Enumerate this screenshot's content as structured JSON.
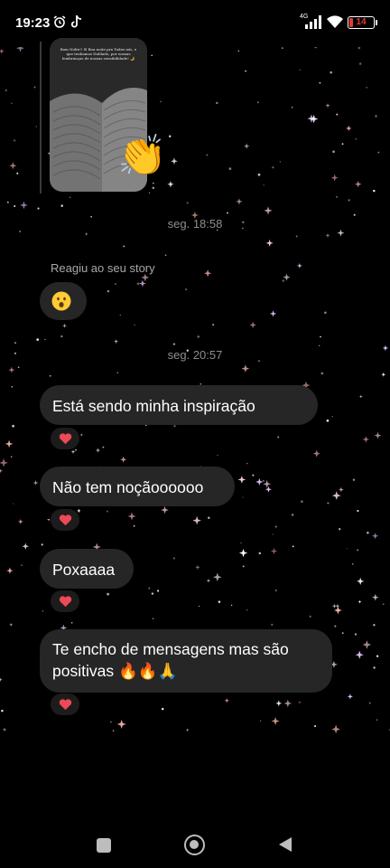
{
  "status_bar": {
    "time": "19:23",
    "network": "4G",
    "battery_level": "14",
    "icons": [
      "alarm-clock-icon",
      "tiktok-icon",
      "signal-icon",
      "wifi-icon",
      "battery-icon"
    ]
  },
  "story": {
    "caption": "Bom Nolte!! ☺ Boa noite pra Todos nós, e que tenhamos Dulilado, por nossas lembranças de nossas sensibilidade! 🌙",
    "reaction_emoji": "👏"
  },
  "messages": {
    "timestamp_1": "seg. 18:58",
    "story_reaction_label": "Reagiu ao seu story",
    "story_reaction_emoji": "surprised-face-icon",
    "timestamp_2": "seg. 20:57",
    "items": [
      {
        "text": "Está sendo minha inspiração",
        "reaction": "heart-icon"
      },
      {
        "text": "Não tem noçãoooooo",
        "reaction": "heart-icon"
      },
      {
        "text": "Poxaaaa",
        "reaction": "heart-icon"
      },
      {
        "text": "Te encho de mensagens mas são positivas 🔥🔥🙏",
        "reaction": "heart-icon"
      }
    ]
  },
  "colors": {
    "background": "#000000",
    "bubble": "#262626",
    "timestamp": "#8e8e8e",
    "heart": "#ed4956",
    "battery_low": "#e53935"
  },
  "nav_bar": {
    "icons": [
      "recent-apps-icon",
      "home-icon",
      "back-icon"
    ]
  }
}
